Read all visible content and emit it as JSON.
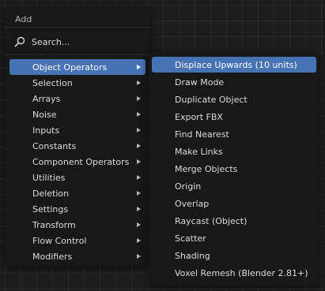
{
  "add_menu": {
    "title": "Add",
    "search_label": "Search...",
    "items": [
      {
        "label": "Object Operators"
      },
      {
        "label": "Selection"
      },
      {
        "label": "Arrays"
      },
      {
        "label": "Noise"
      },
      {
        "label": "Inputs"
      },
      {
        "label": "Constants"
      },
      {
        "label": "Component Operators"
      },
      {
        "label": "Utilities"
      },
      {
        "label": "Deletion"
      },
      {
        "label": "Settings"
      },
      {
        "label": "Transform"
      },
      {
        "label": "Flow Control"
      },
      {
        "label": "Modifiers"
      }
    ],
    "active_index": 0
  },
  "submenu": {
    "items": [
      {
        "label": "Displace Upwards (10 units)"
      },
      {
        "label": "Draw Mode"
      },
      {
        "label": "Duplicate Object"
      },
      {
        "label": "Export FBX"
      },
      {
        "label": "Find Nearest"
      },
      {
        "label": "Make Links"
      },
      {
        "label": "Merge Objects"
      },
      {
        "label": "Origin"
      },
      {
        "label": "Overlap"
      },
      {
        "label": "Raycast (Object)"
      },
      {
        "label": "Scatter"
      },
      {
        "label": "Shading"
      },
      {
        "label": "Voxel Remesh (Blender 2.81+)"
      }
    ],
    "active_index": 0
  },
  "colors": {
    "highlight": "#4772b3",
    "menu_bg": "#181818",
    "canvas_bg": "#1d1d1d"
  },
  "icons": {
    "search": "search-icon",
    "submenu_arrow": "chevron-right-icon"
  }
}
